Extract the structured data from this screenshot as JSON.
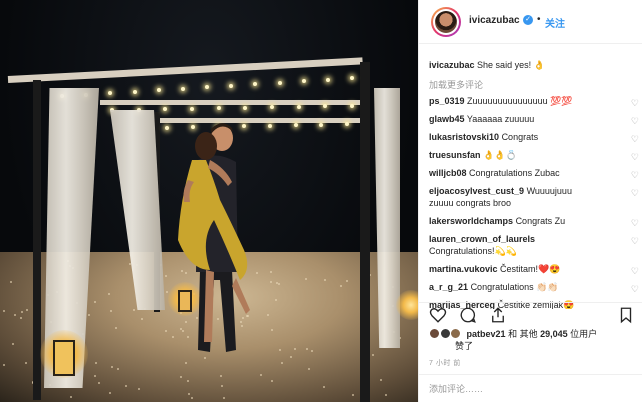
{
  "post": {
    "username": "ivicazubac",
    "follow_label": "关注",
    "dot": "•",
    "caption_user": "ivicazubac",
    "caption_text": "She said yes! 👌",
    "load_more": "加载更多评论",
    "time": "7 小时 前",
    "add_comment_placeholder": "添加评论……"
  },
  "comments": [
    {
      "user": "ps_0319",
      "text": "Zuuuuuuuuuuuuuuu 💯💯"
    },
    {
      "user": "glawb45",
      "text": "Yaaaaaa zuuuuu"
    },
    {
      "user": "lukasristovski10",
      "text": "Congrats"
    },
    {
      "user": "truesunsfan",
      "text": "👌👌💍"
    },
    {
      "user": "willjcb08",
      "text": "Congratulations Zubac"
    },
    {
      "user": "eljoacosylvest_cust_9",
      "text": "Wuuuujuuu",
      "text2": "zuuuu congrats broo"
    },
    {
      "user": "lakersworldchamps",
      "text": "Congrats Zu"
    },
    {
      "user": "lauren_crown_of_laurels",
      "text": "",
      "text2": "Congratulations!💫💫"
    },
    {
      "user": "martina.vukovic",
      "text": "Čestitam!❤️😍"
    },
    {
      "user": "a_r_g_21",
      "text": "Congratulations 👏🏻👏🏻"
    },
    {
      "user": "marijas_herceg",
      "text": "Čestitke zemljak😍"
    }
  ],
  "likes": {
    "user": "patbev21",
    "text_before": " 和 其他 ",
    "count": "29,045",
    "text_after": " 位用户",
    "text_line2": "赞了"
  },
  "icons": [
    "heart-icon",
    "comment-icon",
    "share-icon",
    "bookmark-icon",
    "verified-icon"
  ],
  "colors": {
    "link": "#3897f0",
    "verified": "#3897f0",
    "muted": "#999999"
  }
}
